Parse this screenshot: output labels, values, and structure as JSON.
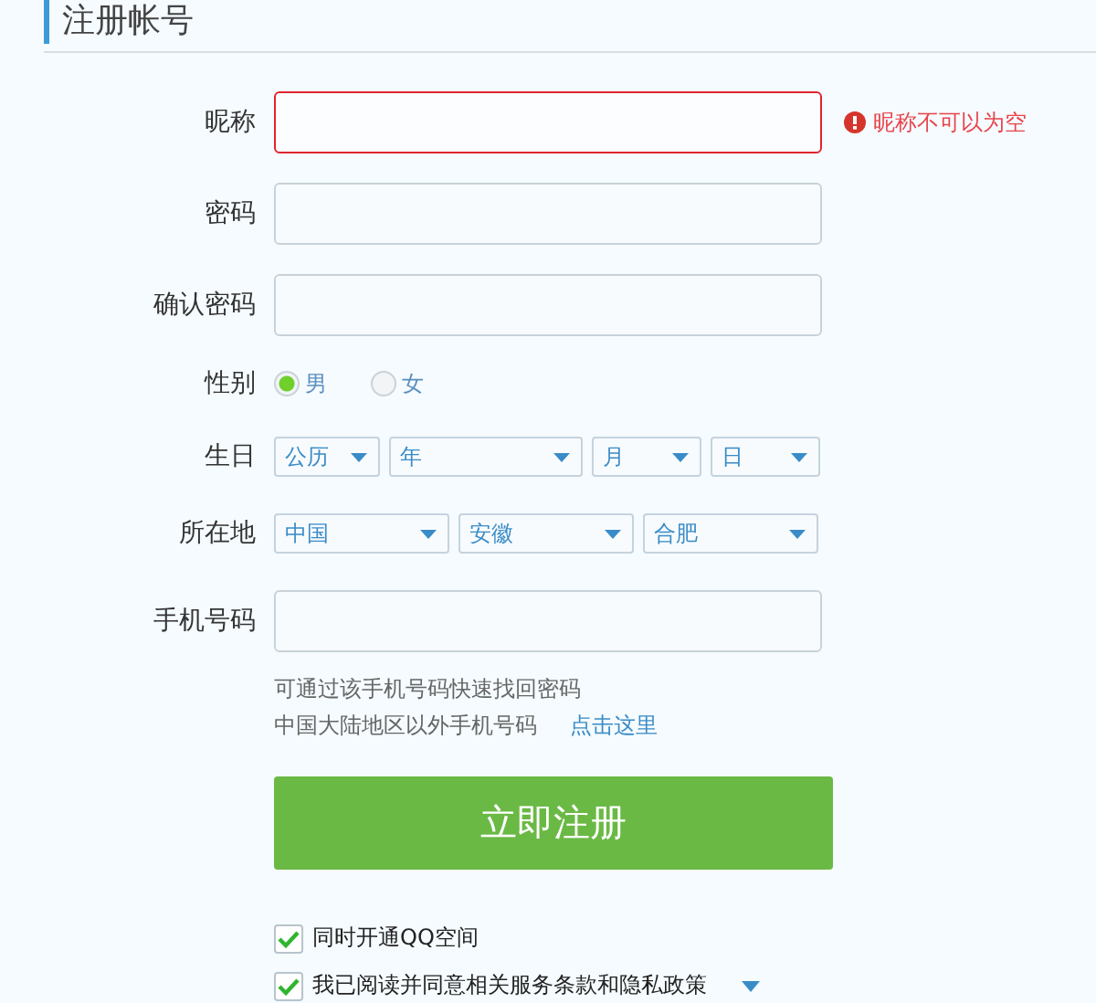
{
  "title": "注册帐号",
  "rows": [
    {
      "kind": "input",
      "label": "昵称",
      "invalid": true,
      "error": "昵称不可以为空"
    },
    {
      "kind": "input",
      "label": "密码",
      "invalid": false
    },
    {
      "kind": "input",
      "label": "确认密码",
      "invalid": false
    },
    {
      "kind": "radio",
      "label": "性别",
      "options": [
        {
          "label": "男",
          "selected": true
        },
        {
          "label": "女",
          "selected": false
        }
      ]
    },
    {
      "kind": "selects",
      "label": "生日",
      "selects": [
        "公历",
        "年",
        "月",
        "日"
      ]
    },
    {
      "kind": "selects",
      "label": "所在地",
      "selects": [
        "中国",
        "安徽",
        "合肥"
      ]
    },
    {
      "kind": "input",
      "label": "手机号码",
      "invalid": false
    }
  ],
  "phone_hint": {
    "line1": "可通过该手机号码快速找回密码",
    "line2": "中国大陆地区以外手机号码",
    "link": "点击这里"
  },
  "submit": "立即注册",
  "agreements": [
    {
      "label": "同时开通QQ空间",
      "checked": true,
      "dropdown": false
    },
    {
      "label": "我已阅读并同意相关服务条款和隐私政策",
      "checked": true,
      "dropdown": true
    }
  ]
}
